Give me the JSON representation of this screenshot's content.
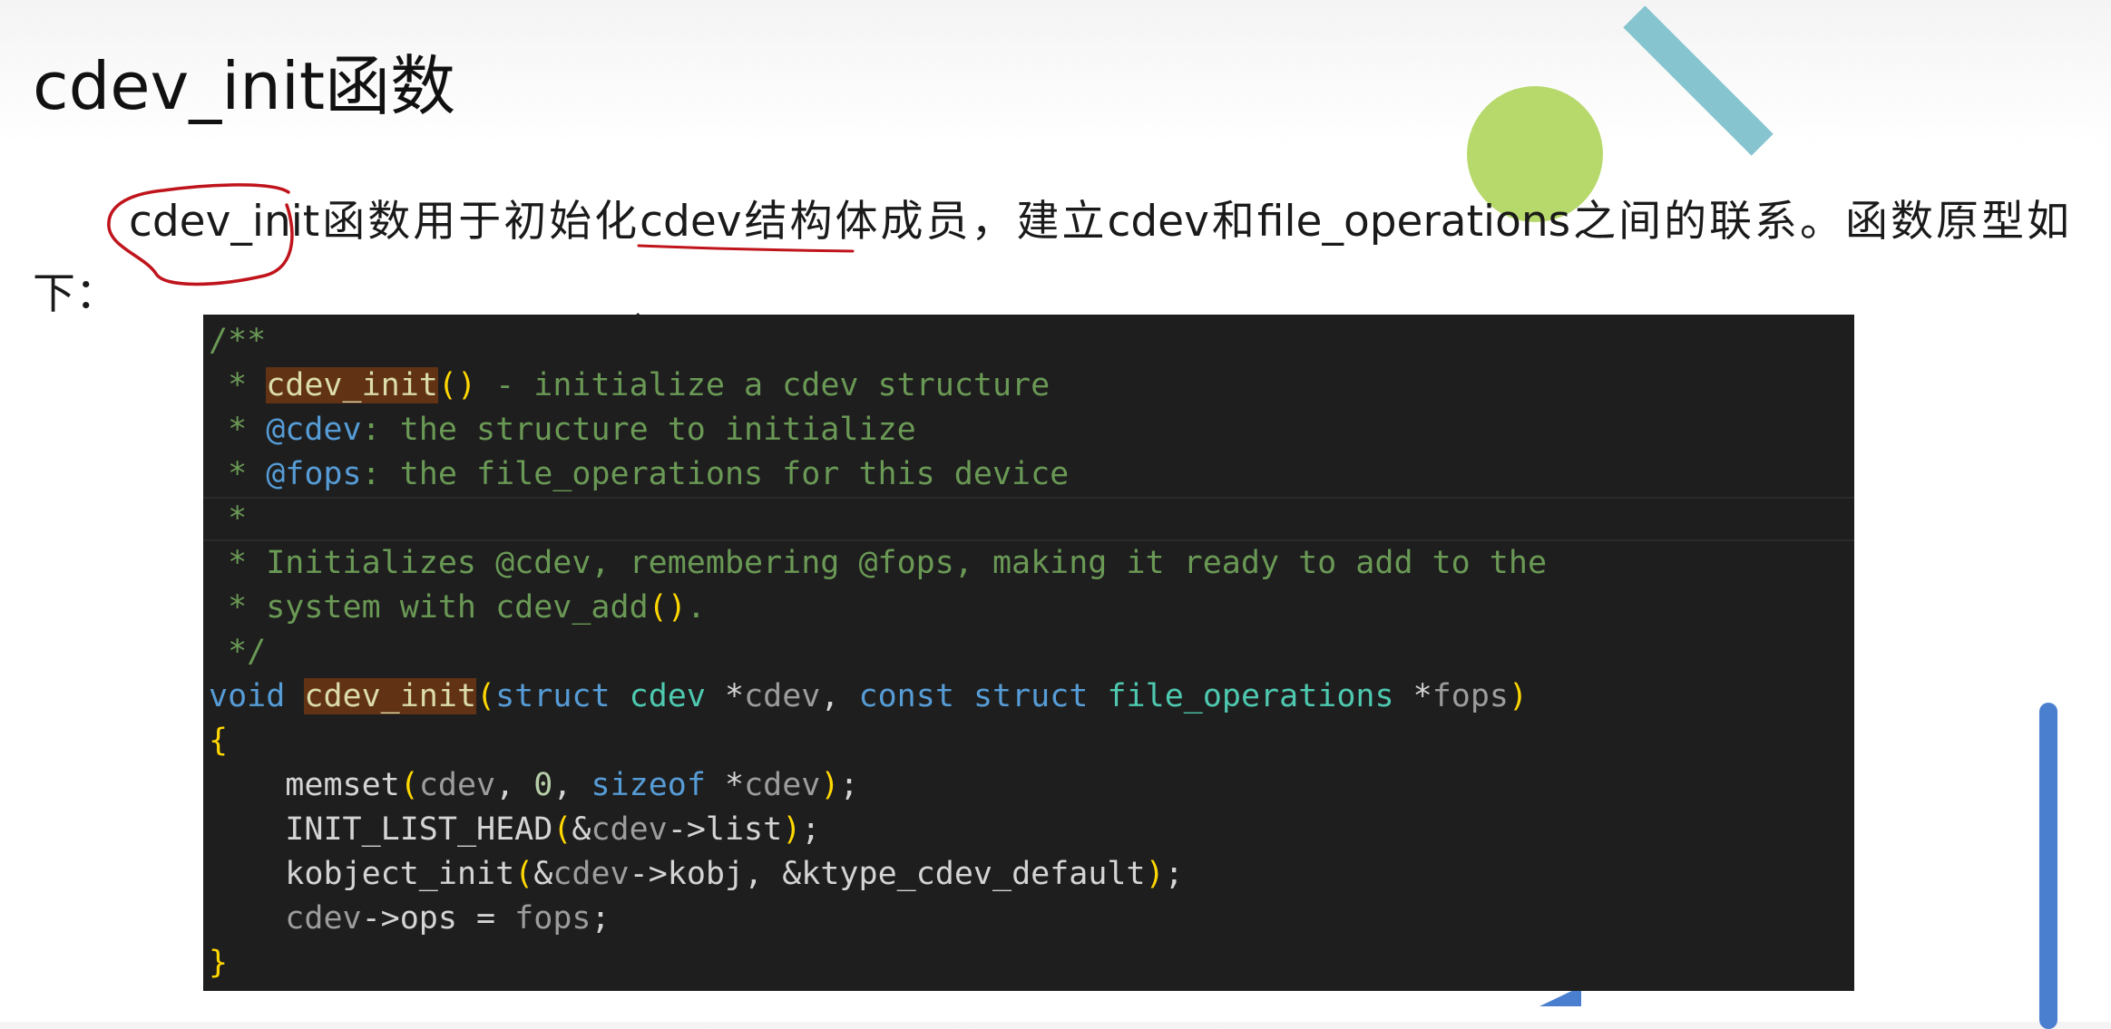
{
  "slide": {
    "title": "cdev_init函数",
    "paragraph": "cdev_init函数用于初始化cdev结构体成员，建立cdev和file_operations之间的联系。函数原型如下："
  },
  "code": {
    "lines": {
      "l1": "/**",
      "l2_star": " * ",
      "l2_fn": "cdev_init",
      "l2_paren": "()",
      "l2_rest": " - initialize a cdev structure",
      "l3_star": " * ",
      "l3_tag": "@cdev",
      "l3_rest": ": the structure to initialize",
      "l4_star": " * ",
      "l4_tag": "@fops",
      "l4_rest": ": the file_operations for this device",
      "l5": " *",
      "l6": " * Initializes @cdev, remembering @fops, making it ready to add to the",
      "l7_a": " * system with cdev_add",
      "l7_paren": "()",
      "l7_b": ".",
      "l8": " */",
      "l9_void": "void",
      "l9_fn": "cdev_init",
      "l9_open": "(",
      "l9_struct1": "struct",
      "l9_type1": "cdev",
      "l9_star1": " *",
      "l9_p1": "cdev",
      "l9_comma": ", ",
      "l9_const": "const",
      "l9_struct2": "struct",
      "l9_type2": "file_operations",
      "l9_star2": " *",
      "l9_p2": "fops",
      "l9_close": ")",
      "l10": "{",
      "l11_fn": "memset",
      "l11_open": "(",
      "l11_var": "cdev",
      "l11_comma": ", ",
      "l11_num": "0",
      "l11_comma2": ", ",
      "l11_kw": "sizeof",
      "l11_star": " *",
      "l11_var2": "cdev",
      "l11_close": ")",
      "l11_semi": ";",
      "l12_fn": "INIT_LIST_HEAD",
      "l12_open": "(",
      "l12_amp": "&",
      "l12_var": "cdev",
      "l12_field": "->list",
      "l12_close": ")",
      "l12_semi": ";",
      "l13_fn": "kobject_init",
      "l13_open": "(",
      "l13_amp": "&",
      "l13_var": "cdev",
      "l13_field": "->kobj",
      "l13_rest": ", &ktype_cdev_default",
      "l13_close": ")",
      "l13_semi": ";",
      "l14_var": "cdev",
      "l14_field": "->ops = ",
      "l14_val": "fops",
      "l14_semi": ";",
      "l15": "}"
    }
  },
  "colors": {
    "deco_green": "#b7d96b",
    "deco_teal": "#86c5d0",
    "deco_blue": "#4a7fd0",
    "annotation_red": "#c0141c"
  }
}
